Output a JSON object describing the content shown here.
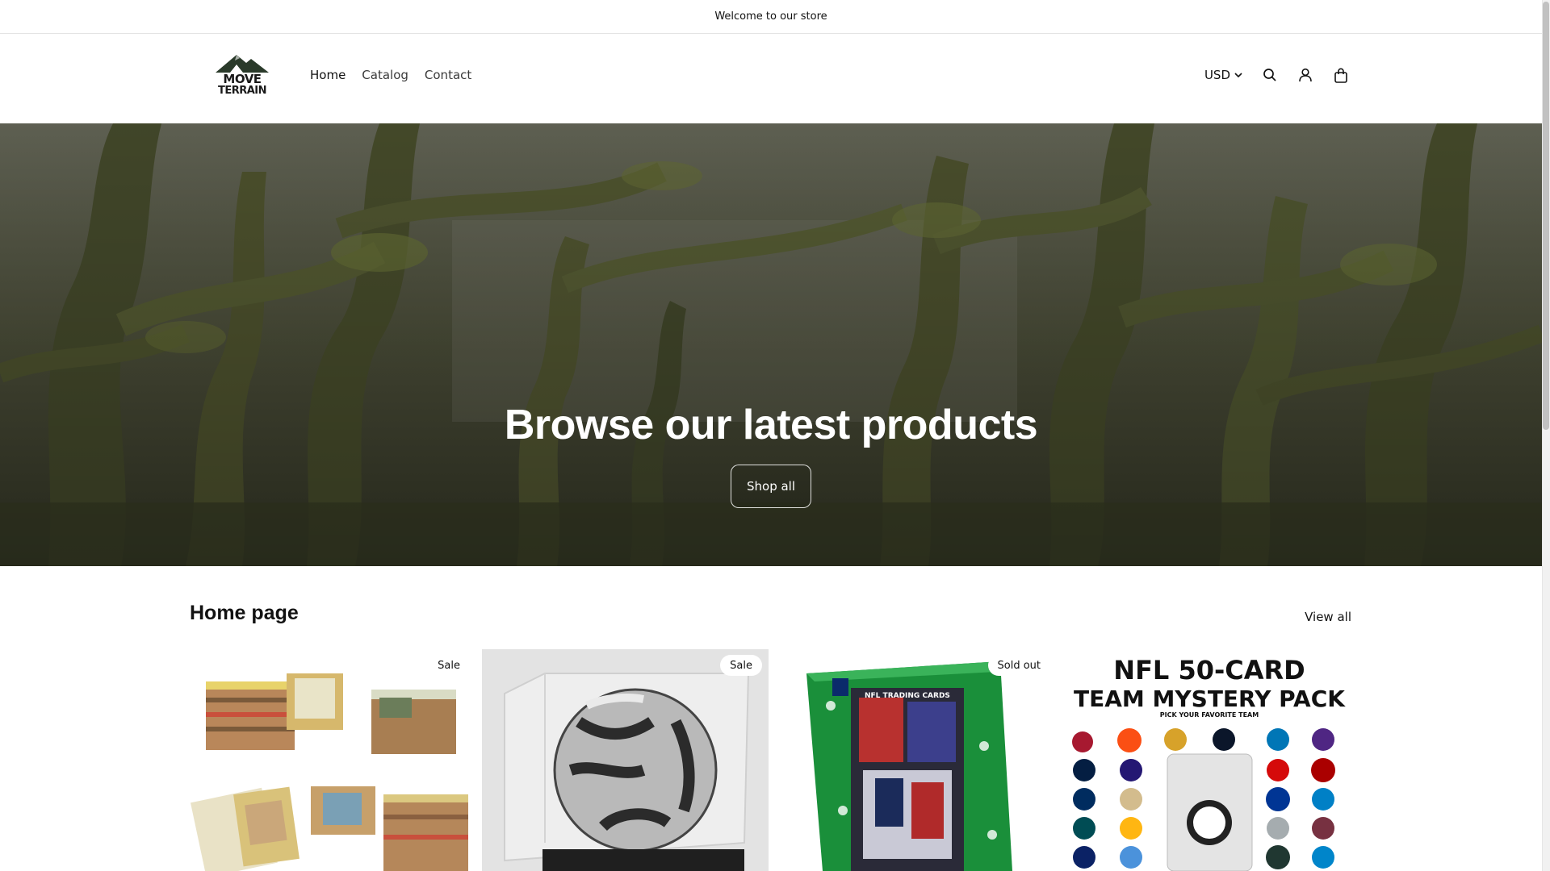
{
  "announcement": {
    "text": "Welcome to our store"
  },
  "logo": {
    "line1": "MOVE",
    "line2": "TERRAIN"
  },
  "nav": {
    "items": [
      "Home",
      "Catalog",
      "Contact"
    ]
  },
  "header": {
    "currency": "USD",
    "icons": [
      "search-icon",
      "account-icon",
      "cart-icon"
    ]
  },
  "hero": {
    "title": "Browse our latest products",
    "button": "Shop all"
  },
  "collection": {
    "title": "Home page",
    "view_all": "View all",
    "products": [
      {
        "badge": "Sale",
        "image": "baseball-cards-stacks"
      },
      {
        "badge": "Sale",
        "image": "soccer-ball-display-case"
      },
      {
        "badge": "Sold out",
        "image": "nfl-trading-cards-box"
      },
      {
        "badge": "",
        "image": "nfl-50-card-team-mystery-pack",
        "image_text": {
          "line1": "NFL 50-CARD",
          "line2": "TEAM MYSTERY PACK",
          "line3": "PICK YOUR FAVORITE TEAM",
          "box_label": "NFL TRADING CARDS"
        }
      }
    ]
  },
  "colors": {
    "text": "#121212",
    "border": "#e4e4e4",
    "hero_moss": "#5b6138",
    "white": "#ffffff"
  }
}
